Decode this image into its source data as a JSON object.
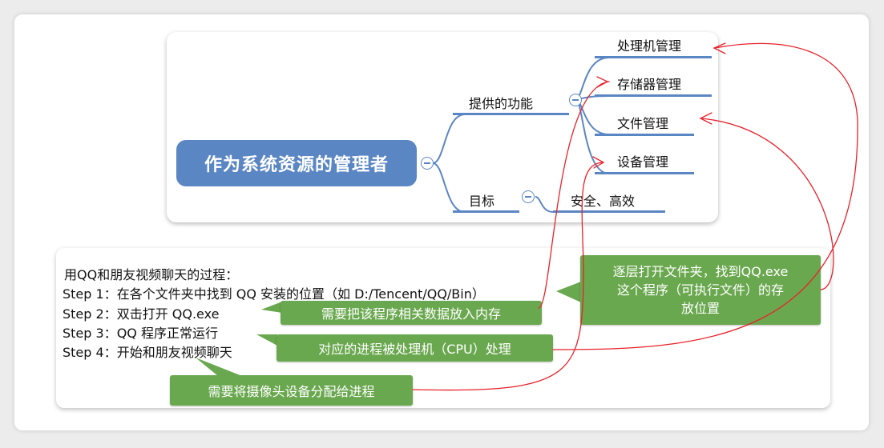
{
  "mindmap": {
    "root": "作为系统资源的管理者",
    "branch_functions": "提供的功能",
    "branch_goal": "目标",
    "goal_value": "安全、高效",
    "functions": [
      "处理机管理",
      "存储器管理",
      "文件管理",
      "设备管理"
    ]
  },
  "process": {
    "heading": "用QQ和朋友视频聊天的过程：",
    "steps": [
      "Step 1：在各个文件夹中找到 QQ 安装的位置（如 D:/Tencent/QQ/Bin）",
      "Step 2：双击打开 QQ.exe",
      "Step 3：QQ 程序正常运行",
      "Step 4：开始和朋友视频聊天"
    ]
  },
  "callouts": {
    "file": [
      "逐层打开文件夹，找到QQ.exe",
      "这个程序（可执行文件）的存",
      "放位置"
    ],
    "memory": "需要把该程序相关数据放入内存",
    "cpu": "对应的进程被处理机（CPU）处理",
    "device": "需要将摄像头设备分配给进程"
  },
  "colors": {
    "node_blue": "#5b86c4",
    "callout_green": "#6aa84f",
    "annotation_red": "#e8212a"
  }
}
